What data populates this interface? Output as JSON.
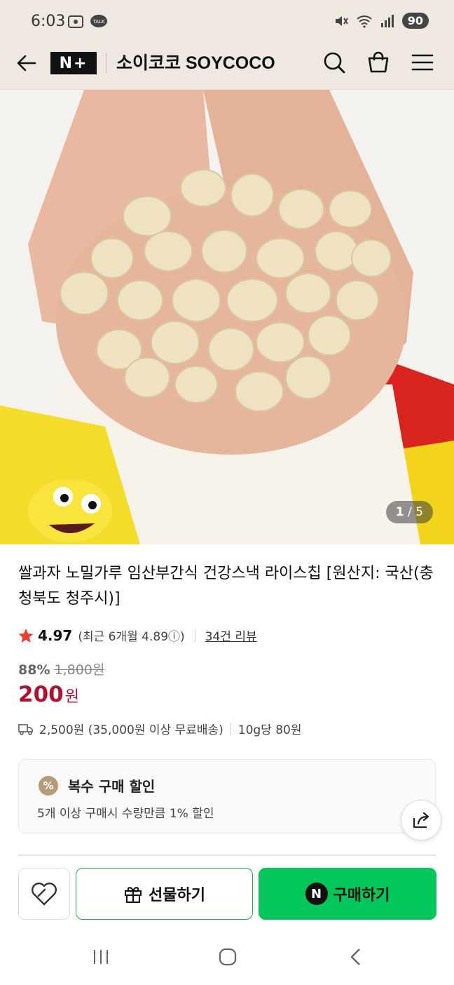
{
  "status": {
    "time": "6:03",
    "battery": "90",
    "left_icons": [
      "screenshot-icon",
      "kakaotalk-icon"
    ],
    "right_icons": [
      "mute-icon",
      "wifi-icon",
      "signal-icon"
    ]
  },
  "header": {
    "back_icon": "back-arrow-icon",
    "logo": "N+",
    "store_name": "소이코코 SOYCOCO",
    "icons": [
      "search-icon",
      "cart-icon",
      "menu-icon"
    ]
  },
  "product": {
    "image_counter_current": "1",
    "image_counter_total": "/ 5",
    "title": "쌀과자 노밀가루 임산부간식 건강스낵 라이스칩 [원산지: 국산(충청북도 청주시)]",
    "rating": "4.97",
    "rating_recent": "(최근 6개월 4.89ⓘ)",
    "review_link": "34건 리뷰",
    "discount_rate": "88%",
    "original_price": "1,800원",
    "price": "200",
    "price_unit": "원",
    "shipping": "2,500원 (35,000원 이상 무료배송)",
    "unit_price": "10g당 80원"
  },
  "multi_discount": {
    "title": "복수 구매 할인",
    "description": "5개 이상 구매시 수량만큼 1% 할인",
    "icon": "%"
  },
  "actions": {
    "gift_label": "선물하기",
    "buy_label": "구매하기",
    "npay_mark": "N"
  },
  "colors": {
    "price_red": "#b0122d",
    "naver_green": "#03c75a",
    "header_bg": "#efe8e1"
  }
}
